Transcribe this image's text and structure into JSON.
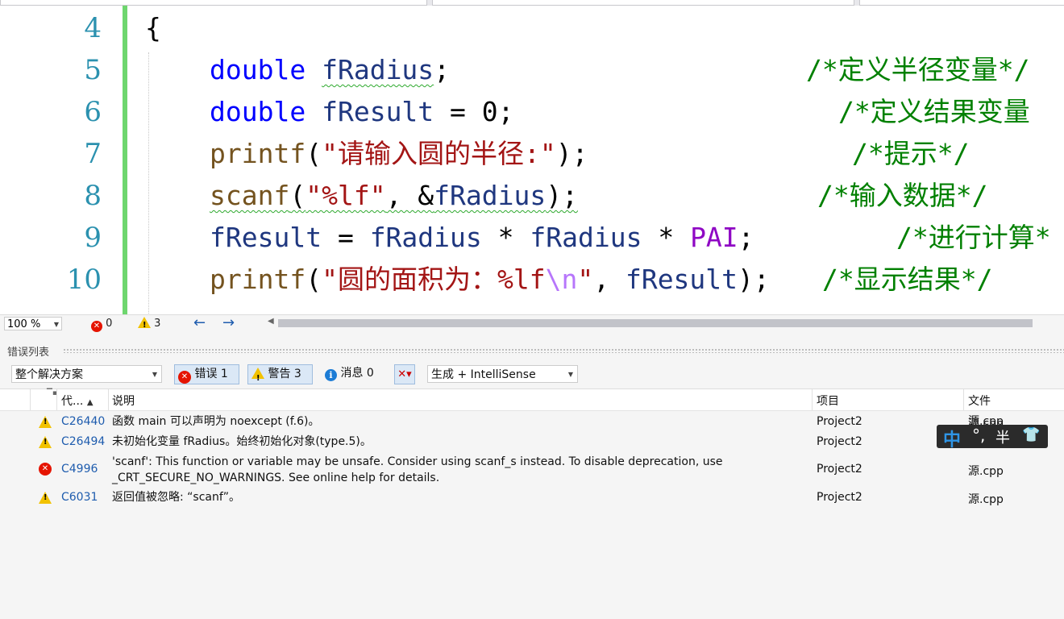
{
  "editor": {
    "lines": [
      {
        "num": "4",
        "code": "{"
      },
      {
        "num": "5",
        "type": "double",
        "var": "fRadius",
        "end": ";",
        "comment": "/*定义半径变量*/"
      },
      {
        "num": "6",
        "type": "double",
        "var": "fResult",
        "mid": " = 0;",
        "comment": "/*定义结果变量"
      },
      {
        "num": "7",
        "fn": "printf",
        "open": "(",
        "str": "\"请输入圆的半径:\"",
        "close": ");",
        "comment": "/*提示*/"
      },
      {
        "num": "8",
        "fn": "scanf",
        "open": "(",
        "str": "\"%lf\"",
        "mid": ", &",
        "var": "fRadius",
        "close": ");",
        "comment": "/*输入数据*/"
      },
      {
        "num": "9",
        "a": "fResult",
        "eq": " = ",
        "b": "fRadius",
        "mul1": " * ",
        "c": "fRadius",
        "mul2": " * ",
        "macro": "PAI",
        "end": ";",
        "comment": "/*进行计算*"
      },
      {
        "num": "10",
        "fn": "printf",
        "open": "(",
        "str": "\"圆的面积为：%lf",
        "esc": "\\n",
        "strend": "\"",
        "mid": ", ",
        "var": "fResult",
        "close": ");",
        "comment": "/*显示结果*/"
      }
    ]
  },
  "status": {
    "zoom": "100 %",
    "errors": "0",
    "warnings": "3"
  },
  "error_list": {
    "title": "错误列表",
    "scope": "整个解决方案",
    "errors_btn": "错误 1",
    "warnings_btn": "警告 3",
    "messages": "消息 0",
    "build_filter": "生成 + IntelliSense",
    "columns": {
      "code": "代...",
      "description": "说明",
      "project": "项目",
      "file": "文件"
    },
    "rows": [
      {
        "severity": "warning",
        "code": "C26440",
        "description": "函数 main 可以声明为 noexcept (f.6)。",
        "project": "Project2",
        "file": "源.cpp"
      },
      {
        "severity": "warning",
        "code": "C26494",
        "description": "未初始化变量 fRadius。始终初始化对象(type.5)。",
        "project": "Project2",
        "file": ""
      },
      {
        "severity": "error",
        "code": "C4996",
        "description": "'scanf': This function or variable may be unsafe. Consider using scanf_s instead. To disable deprecation, use _CRT_SECURE_NO_WARNINGS. See online help for details.",
        "project": "Project2",
        "file": "源.cpp"
      },
      {
        "severity": "warning",
        "code": "C6031",
        "description": "返回值被忽略: “scanf”。",
        "project": "Project2",
        "file": "源.cpp"
      }
    ]
  },
  "ime": {
    "lang": "中",
    "punct": "°,",
    "width": "半",
    "skin_icon": "shirt-icon"
  }
}
